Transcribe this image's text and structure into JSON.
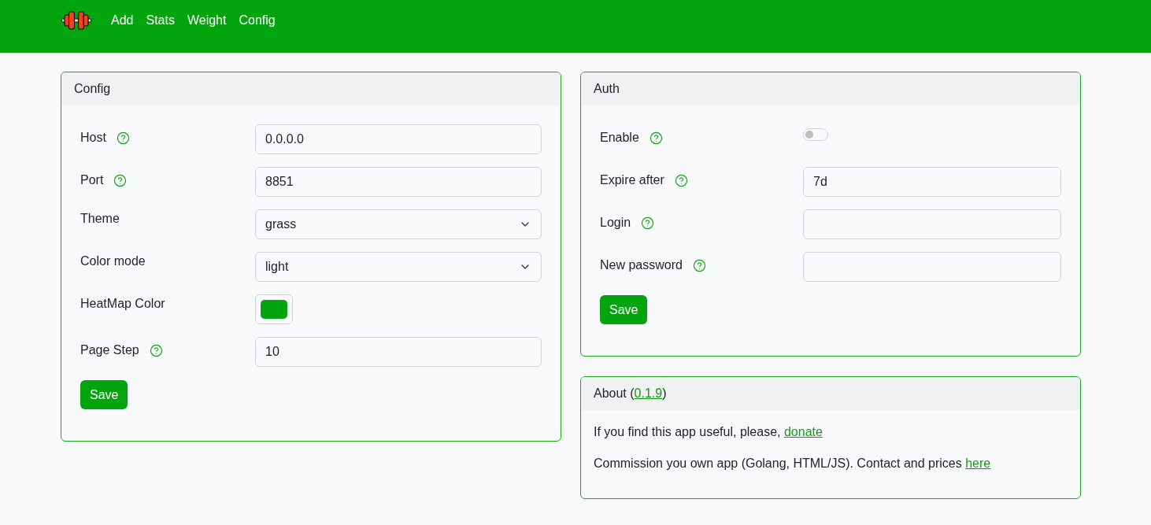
{
  "navbar": {
    "links": [
      {
        "label": "Add"
      },
      {
        "label": "Stats"
      },
      {
        "label": "Weight"
      },
      {
        "label": "Config"
      }
    ]
  },
  "config": {
    "title": "Config",
    "fields": [
      {
        "kind": "text",
        "label": "Host",
        "help": true,
        "value": "0.0.0.0"
      },
      {
        "kind": "text",
        "label": "Port",
        "help": true,
        "value": "8851"
      },
      {
        "kind": "select",
        "label": "Theme",
        "help": false,
        "value": "grass"
      },
      {
        "kind": "select",
        "label": "Color mode",
        "help": false,
        "value": "light"
      },
      {
        "kind": "color",
        "label": "HeatMap Color",
        "help": false,
        "color": "#03a50f"
      },
      {
        "kind": "text",
        "label": "Page Step",
        "help": true,
        "value": "10"
      }
    ],
    "save": "Save"
  },
  "auth": {
    "title": "Auth",
    "fields": [
      {
        "kind": "toggle",
        "label": "Enable",
        "help": true,
        "on": false
      },
      {
        "kind": "text",
        "label": "Expire after",
        "help": true,
        "value": "7d"
      },
      {
        "kind": "text",
        "label": "Login",
        "help": true
      },
      {
        "kind": "password",
        "label": "New password",
        "help": true
      }
    ],
    "save": "Save"
  },
  "about": {
    "title": [
      {
        "kind": "text",
        "text": "About ("
      },
      {
        "kind": "link",
        "text": "0.1.9"
      },
      {
        "kind": "text",
        "text": ")"
      }
    ],
    "paragraphs": [
      {
        "segments": [
          {
            "kind": "text",
            "text": "If you find this app useful, please, "
          },
          {
            "kind": "link",
            "text": "donate"
          }
        ]
      },
      {
        "segments": [
          {
            "kind": "text",
            "text": "Commission you own app (Golang, HTML/JS). Contact and prices "
          },
          {
            "kind": "link",
            "text": "here"
          }
        ]
      }
    ]
  }
}
